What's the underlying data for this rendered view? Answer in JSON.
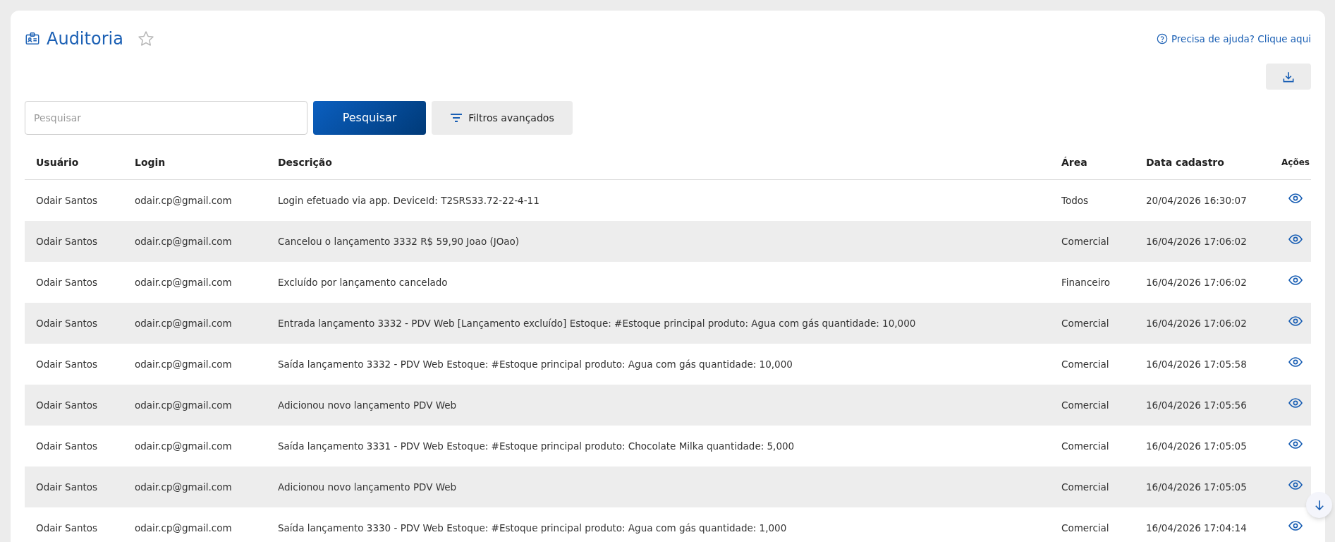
{
  "page": {
    "title": "Auditoria",
    "favorite": false,
    "help_link": "Precisa de ajuda? Clique aqui"
  },
  "search": {
    "placeholder": "Pesquisar",
    "button": "Pesquisar",
    "filters_button": "Filtros avançados"
  },
  "table": {
    "columns": [
      "Usuário",
      "Login",
      "Descrição",
      "Área",
      "Data cadastro",
      "Ações"
    ],
    "rows": [
      {
        "user": "Odair Santos",
        "login": "odair.cp@gmail.com",
        "description": "Login efetuado via app. DeviceId: T2SRS33.72-22-4-11",
        "area": "Todos",
        "date": "20/04/2026 16:30:07"
      },
      {
        "user": "Odair Santos",
        "login": "odair.cp@gmail.com",
        "description": "Cancelou o lançamento 3332 R$ 59,90 Joao (JOao)",
        "area": "Comercial",
        "date": "16/04/2026 17:06:02"
      },
      {
        "user": "Odair Santos",
        "login": "odair.cp@gmail.com",
        "description": "Excluído por lançamento cancelado",
        "area": "Financeiro",
        "date": "16/04/2026 17:06:02"
      },
      {
        "user": "Odair Santos",
        "login": "odair.cp@gmail.com",
        "description": "Entrada lançamento 3332 - PDV Web [Lançamento excluído] Estoque: #Estoque principal produto: Agua com gás quantidade: 10,000",
        "area": "Comercial",
        "date": "16/04/2026 17:06:02"
      },
      {
        "user": "Odair Santos",
        "login": "odair.cp@gmail.com",
        "description": "Saída lançamento 3332 - PDV Web Estoque: #Estoque principal produto: Agua com gás quantidade: 10,000",
        "area": "Comercial",
        "date": "16/04/2026 17:05:58"
      },
      {
        "user": "Odair Santos",
        "login": "odair.cp@gmail.com",
        "description": "Adicionou novo lançamento PDV Web",
        "area": "Comercial",
        "date": "16/04/2026 17:05:56"
      },
      {
        "user": "Odair Santos",
        "login": "odair.cp@gmail.com",
        "description": "Saída lançamento 3331 - PDV Web Estoque: #Estoque principal produto: Chocolate Milka quantidade: 5,000",
        "area": "Comercial",
        "date": "16/04/2026 17:05:05"
      },
      {
        "user": "Odair Santos",
        "login": "odair.cp@gmail.com",
        "description": "Adicionou novo lançamento PDV Web",
        "area": "Comercial",
        "date": "16/04/2026 17:05:05"
      },
      {
        "user": "Odair Santos",
        "login": "odair.cp@gmail.com",
        "description": "Saída lançamento 3330 - PDV Web Estoque: #Estoque principal produto: Agua com gás quantidade: 1,000",
        "area": "Comercial",
        "date": "16/04/2026 17:04:14"
      }
    ]
  }
}
